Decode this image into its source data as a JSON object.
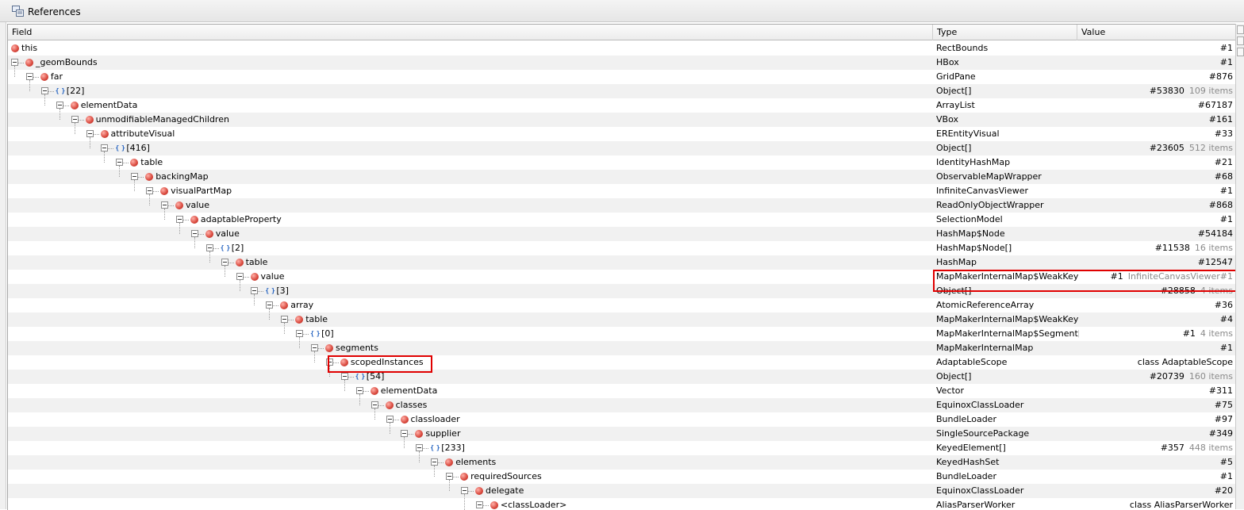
{
  "window": {
    "title": "References",
    "title_icon": "references-icon"
  },
  "columns": {
    "field": "Field",
    "type": "Type",
    "value": "Value"
  },
  "rows": [
    {
      "depth": 0,
      "kind": "node",
      "name": "this",
      "type": "RectBounds",
      "value": "#1",
      "extra": "",
      "expandable": false
    },
    {
      "depth": 0,
      "kind": "node",
      "name": "_geomBounds",
      "type": "HBox",
      "value": "#1",
      "extra": "",
      "expandable": true
    },
    {
      "depth": 1,
      "kind": "node",
      "name": "far",
      "type": "GridPane",
      "value": "#876",
      "extra": "",
      "expandable": true
    },
    {
      "depth": 2,
      "kind": "array",
      "name": "[22]",
      "type": "Object[]",
      "value": "#53830",
      "extra": "109 items",
      "expandable": true
    },
    {
      "depth": 3,
      "kind": "node",
      "name": "elementData",
      "type": "ArrayList",
      "value": "#67187",
      "extra": "",
      "expandable": true
    },
    {
      "depth": 4,
      "kind": "node",
      "name": "unmodifiableManagedChildren",
      "type": "VBox",
      "value": "#161",
      "extra": "",
      "expandable": true
    },
    {
      "depth": 5,
      "kind": "node",
      "name": "attributeVisual",
      "type": "EREntityVisual",
      "value": "#33",
      "extra": "",
      "expandable": true
    },
    {
      "depth": 6,
      "kind": "array",
      "name": "[416]",
      "type": "Object[]",
      "value": "#23605",
      "extra": "512 items",
      "expandable": true
    },
    {
      "depth": 7,
      "kind": "node",
      "name": "table",
      "type": "IdentityHashMap",
      "value": "#21",
      "extra": "",
      "expandable": true
    },
    {
      "depth": 8,
      "kind": "node",
      "name": "backingMap",
      "type": "ObservableMapWrapper",
      "value": "#68",
      "extra": "",
      "expandable": true
    },
    {
      "depth": 9,
      "kind": "node",
      "name": "visualPartMap",
      "type": "InfiniteCanvasViewer",
      "value": "#1",
      "extra": "",
      "expandable": true
    },
    {
      "depth": 10,
      "kind": "node",
      "name": "value",
      "type": "ReadOnlyObjectWrapper",
      "value": "#868",
      "extra": "",
      "expandable": true
    },
    {
      "depth": 11,
      "kind": "node",
      "name": "adaptableProperty",
      "type": "SelectionModel",
      "value": "#1",
      "extra": "",
      "expandable": true
    },
    {
      "depth": 12,
      "kind": "node",
      "name": "value",
      "type": "HashMap$Node",
      "value": "#54184",
      "extra": "",
      "expandable": true
    },
    {
      "depth": 13,
      "kind": "array",
      "name": "[2]",
      "type": "HashMap$Node[]",
      "value": "#11538",
      "extra": "16 items",
      "expandable": true
    },
    {
      "depth": 14,
      "kind": "node",
      "name": "table",
      "type": "HashMap",
      "value": "#12547",
      "extra": "",
      "expandable": true
    },
    {
      "depth": 15,
      "kind": "node",
      "name": "value",
      "type": "MapMakerInternalMap$WeakKey…",
      "value": "#1",
      "extra": "InfiniteCanvasViewer#1",
      "expandable": true
    },
    {
      "depth": 16,
      "kind": "array",
      "name": "[3]",
      "type": "Object[]",
      "value": "#28858",
      "extra": "4 items",
      "expandable": true
    },
    {
      "depth": 17,
      "kind": "node",
      "name": "array",
      "type": "AtomicReferenceArray",
      "value": "#36",
      "extra": "",
      "expandable": true
    },
    {
      "depth": 18,
      "kind": "node",
      "name": "table",
      "type": "MapMakerInternalMap$WeakKey…",
      "value": "#4",
      "extra": "",
      "expandable": true
    },
    {
      "depth": 19,
      "kind": "array",
      "name": "[0]",
      "type": "MapMakerInternalMap$Segment[]",
      "value": "#1",
      "extra": "4 items",
      "expandable": true
    },
    {
      "depth": 20,
      "kind": "node",
      "name": "segments",
      "type": "MapMakerInternalMap",
      "value": "#1",
      "extra": "",
      "expandable": true
    },
    {
      "depth": 21,
      "kind": "static",
      "name": "scopedInstances",
      "type": "AdaptableScope",
      "value": "class AdaptableScope",
      "extra": "",
      "expandable": true
    },
    {
      "depth": 22,
      "kind": "array",
      "name": "[54]",
      "type": "Object[]",
      "value": "#20739",
      "extra": "160 items",
      "expandable": true
    },
    {
      "depth": 23,
      "kind": "node",
      "name": "elementData",
      "type": "Vector",
      "value": "#311",
      "extra": "",
      "expandable": true
    },
    {
      "depth": 24,
      "kind": "node",
      "name": "classes",
      "type": "EquinoxClassLoader",
      "value": "#75",
      "extra": "",
      "expandable": true
    },
    {
      "depth": 25,
      "kind": "node",
      "name": "classloader",
      "type": "BundleLoader",
      "value": "#97",
      "extra": "",
      "expandable": true
    },
    {
      "depth": 26,
      "kind": "node",
      "name": "supplier",
      "type": "SingleSourcePackage",
      "value": "#349",
      "extra": "",
      "expandable": true
    },
    {
      "depth": 27,
      "kind": "array",
      "name": "[233]",
      "type": "KeyedElement[]",
      "value": "#357",
      "extra": "448 items",
      "expandable": true
    },
    {
      "depth": 28,
      "kind": "node",
      "name": "elements",
      "type": "KeyedHashSet",
      "value": "#5",
      "extra": "",
      "expandable": true
    },
    {
      "depth": 29,
      "kind": "node",
      "name": "requiredSources",
      "type": "BundleLoader",
      "value": "#1",
      "extra": "",
      "expandable": true
    },
    {
      "depth": 30,
      "kind": "node",
      "name": "delegate",
      "type": "EquinoxClassLoader",
      "value": "#20",
      "extra": "",
      "expandable": true
    },
    {
      "depth": 31,
      "kind": "static",
      "name": "<classLoader>",
      "type": "AliasParserWorker",
      "value": "class AliasParserWorker",
      "extra": "",
      "expandable": true
    }
  ]
}
